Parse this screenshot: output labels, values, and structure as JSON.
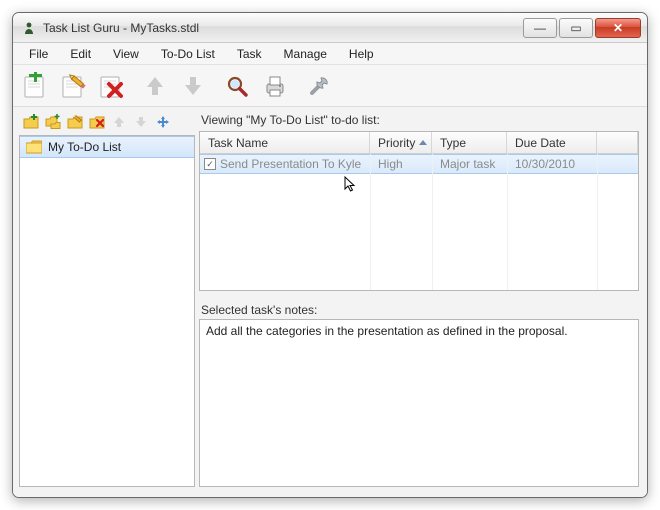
{
  "window": {
    "title": "Task List Guru - MyTasks.stdl"
  },
  "menu": {
    "items": [
      "File",
      "Edit",
      "View",
      "To-Do List",
      "Task",
      "Manage",
      "Help"
    ]
  },
  "sidebar": {
    "items": [
      {
        "label": "My To-Do List"
      }
    ]
  },
  "viewing_label": "Viewing \"My To-Do List\" to-do list:",
  "columns": {
    "name": "Task Name",
    "priority": "Priority",
    "type": "Type",
    "due": "Due Date"
  },
  "rows": [
    {
      "done": true,
      "name": "Send Presentation To Kyle",
      "priority": "High",
      "type": "Major task",
      "due": "10/30/2010"
    }
  ],
  "notes_label": "Selected task's notes:",
  "notes_text": "Add all the categories in the presentation as defined in the proposal.",
  "icons": {
    "minimize": "—",
    "maximize": "▭",
    "close": "✕"
  }
}
